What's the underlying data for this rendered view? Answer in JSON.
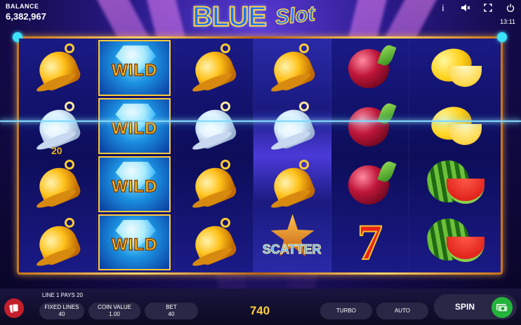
{
  "header": {
    "balance_label": "BALANCE",
    "balance_value": "6,382,967",
    "logo_main": "BLUE",
    "logo_script": "Slot",
    "clock": "13:11",
    "icons": [
      "info-icon",
      "sound-off-icon",
      "fullscreen-icon",
      "power-icon"
    ]
  },
  "reels": {
    "wild_label": "WILD",
    "scatter_label": "SCATTER",
    "win_multiplier": "20",
    "symbols": [
      [
        "bell",
        "bell-lit",
        "bell",
        "bell"
      ],
      [
        "wild",
        "wild",
        "wild",
        "wild"
      ],
      [
        "bell",
        "bell-lit",
        "bell",
        "bell"
      ],
      [
        "bell",
        "bell-lit",
        "bell",
        "scatter"
      ],
      [
        "plum",
        "plum",
        "plum",
        "seven"
      ],
      [
        "lemon",
        "lemon",
        "watermelon",
        "watermelon"
      ]
    ]
  },
  "footer": {
    "line_info": "LINE 1 PAYS 20",
    "fixed_lines_label": "FIXED LINES",
    "fixed_lines_value": "40",
    "coin_value_label": "COIN VALUE",
    "coin_value_value": "1.00",
    "bet_label": "BET",
    "bet_value": "40",
    "win_value": "740",
    "turbo_label": "TURBO",
    "auto_label": "AUTO",
    "spin_label": "SPIN"
  },
  "colors": {
    "payline": "#7fd8ff",
    "frame_gold": "#ffd564",
    "win_text": "#ffcf3a"
  }
}
